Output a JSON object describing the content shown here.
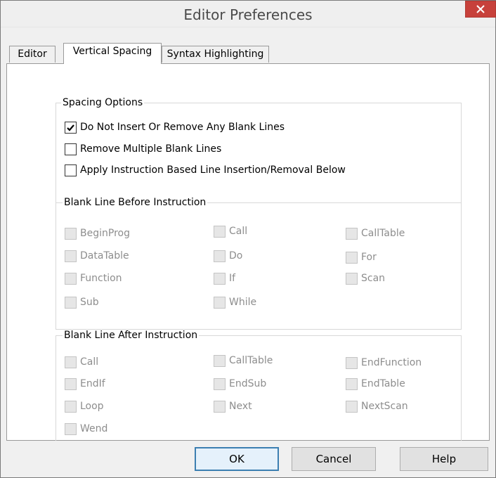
{
  "window": {
    "title": "Editor Preferences"
  },
  "tabs": [
    {
      "label": "Editor"
    },
    {
      "label": "Vertical Spacing"
    },
    {
      "label": "Syntax Highlighting"
    }
  ],
  "spacing_options": {
    "title": "Spacing Options",
    "items": [
      {
        "label": "Do Not Insert Or Remove Any Blank Lines",
        "checked": true
      },
      {
        "label": "Remove Multiple Blank Lines",
        "checked": false
      },
      {
        "label": "Apply Instruction Based Line Insertion/Removal Below",
        "checked": false
      }
    ]
  },
  "blank_before": {
    "title": "Blank Line Before Instruction",
    "items": [
      {
        "label": "BeginProg"
      },
      {
        "label": "Call"
      },
      {
        "label": "CallTable"
      },
      {
        "label": "DataTable"
      },
      {
        "label": "Do"
      },
      {
        "label": "For"
      },
      {
        "label": "Function"
      },
      {
        "label": "If"
      },
      {
        "label": "Scan"
      },
      {
        "label": "Sub"
      },
      {
        "label": "While"
      }
    ]
  },
  "blank_after": {
    "title": "Blank Line After Instruction",
    "items": [
      {
        "label": "Call"
      },
      {
        "label": "CallTable"
      },
      {
        "label": "EndFunction"
      },
      {
        "label": "EndIf"
      },
      {
        "label": "EndSub"
      },
      {
        "label": "EndTable"
      },
      {
        "label": "Loop"
      },
      {
        "label": "Next"
      },
      {
        "label": "NextScan"
      },
      {
        "label": "Wend"
      }
    ]
  },
  "buttons": {
    "ok": "OK",
    "cancel": "Cancel",
    "help": "Help"
  }
}
